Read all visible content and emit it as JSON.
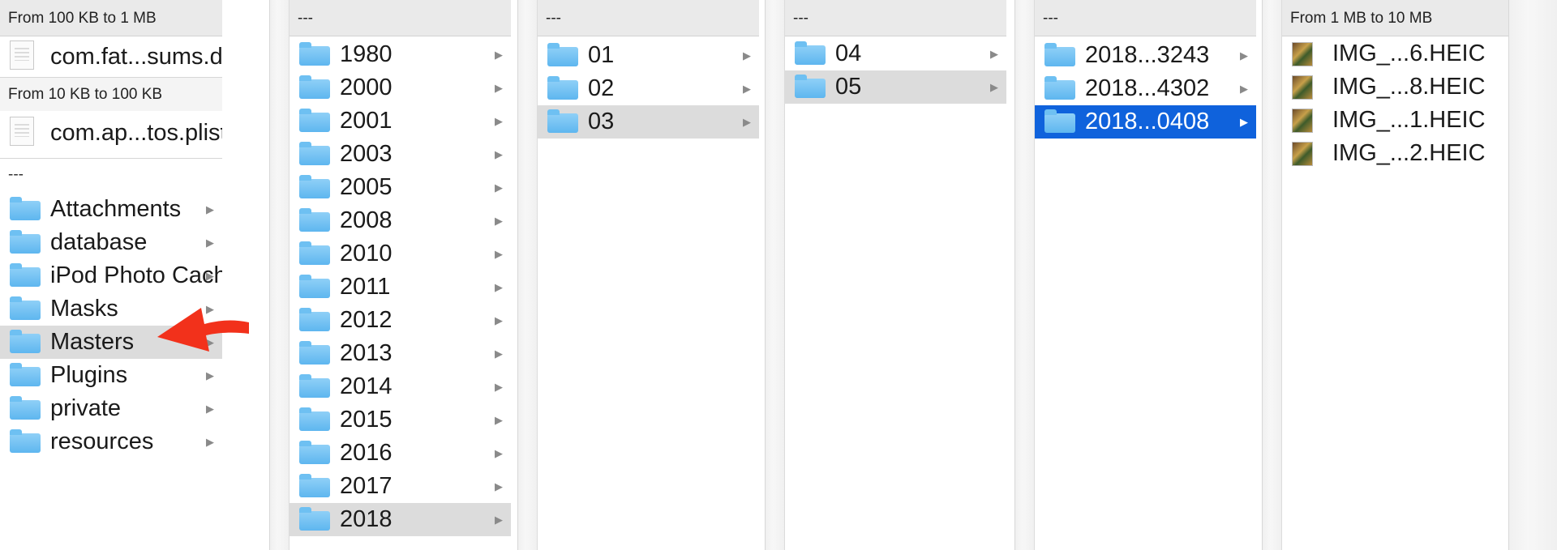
{
  "columns": [
    {
      "sections": [
        {
          "header": "From 100 KB to 1 MB",
          "files": [
            {
              "name": "com.fat...sums.db",
              "icon": "document-icon"
            }
          ]
        },
        {
          "header": "From 10 KB to 100 KB",
          "files": [
            {
              "name": "com.ap...tos.plist",
              "icon": "plist-icon"
            }
          ]
        }
      ],
      "group_header": "---",
      "items": [
        "Attachments",
        "database",
        "iPod Photo Cache",
        "Masks",
        "Masters",
        "Plugins",
        "private",
        "resources"
      ],
      "selected": "Masters"
    },
    {
      "header": "---",
      "items": [
        "1980",
        "2000",
        "2001",
        "2003",
        "2005",
        "2008",
        "2010",
        "2011",
        "2012",
        "2013",
        "2014",
        "2015",
        "2016",
        "2017",
        "2018"
      ],
      "selected": "2018"
    },
    {
      "header": "---",
      "items": [
        "01",
        "02",
        "03"
      ],
      "selected": "03"
    },
    {
      "header": "---",
      "items": [
        "04",
        "05"
      ],
      "selected": "05"
    },
    {
      "header": "---",
      "items": [
        "2018...3243",
        "2018...4302",
        "2018...0408"
      ],
      "selected": "2018...0408"
    },
    {
      "header": "From 1 MB to 10 MB",
      "items": [
        "IMG_...6.HEIC",
        "IMG_...8.HEIC",
        "IMG_...1.HEIC",
        "IMG_...2.HEIC"
      ]
    }
  ],
  "colors": {
    "selection_blue": "#0f62dc",
    "selection_gray": "#dcdcdc",
    "folder_blue": "#6ec0f2",
    "annotation_red": "#f2311b"
  },
  "icons": {
    "folder": "folder-icon",
    "disclosure": "chevron-right-icon",
    "image": "image-thumbnail-icon",
    "annotation": "red-arrow-annotation"
  }
}
